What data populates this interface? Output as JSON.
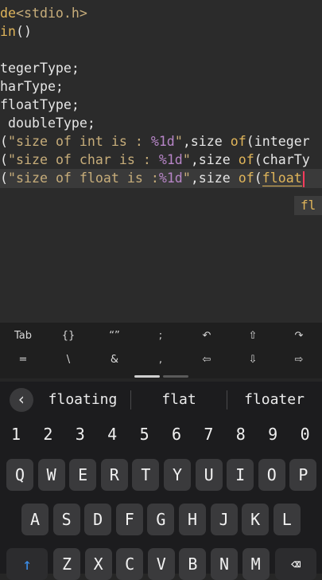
{
  "editor": {
    "lines": [
      {
        "segments": [
          {
            "t": "de",
            "c": "kw"
          },
          {
            "t": "<stdio.h>",
            "c": "str"
          }
        ]
      },
      {
        "segments": [
          {
            "t": "in",
            "c": "kw"
          },
          {
            "t": "()",
            "c": ""
          }
        ]
      },
      {
        "segments": []
      },
      {
        "segments": [
          {
            "t": "tegerType;",
            "c": ""
          }
        ]
      },
      {
        "segments": [
          {
            "t": "harType;",
            "c": ""
          }
        ]
      },
      {
        "segments": [
          {
            "t": "floatType;",
            "c": ""
          }
        ]
      },
      {
        "segments": [
          {
            "t": " doubleType;",
            "c": ""
          }
        ]
      },
      {
        "segments": [
          {
            "t": "(",
            "c": ""
          },
          {
            "t": "\"size of int is : ",
            "c": "str"
          },
          {
            "t": "%1d",
            "c": "fmt"
          },
          {
            "t": "\"",
            "c": "str"
          },
          {
            "t": ",size ",
            "c": ""
          },
          {
            "t": "of",
            "c": "kw"
          },
          {
            "t": "(integer",
            "c": ""
          }
        ]
      },
      {
        "segments": [
          {
            "t": "(",
            "c": ""
          },
          {
            "t": "\"size of char is : ",
            "c": "str"
          },
          {
            "t": "%1d",
            "c": "fmt"
          },
          {
            "t": "\"",
            "c": "str"
          },
          {
            "t": ",size ",
            "c": ""
          },
          {
            "t": "of",
            "c": "kw"
          },
          {
            "t": "(charTy",
            "c": ""
          }
        ]
      },
      {
        "segments": [
          {
            "t": "(",
            "c": ""
          },
          {
            "t": "\"size of float is :",
            "c": "str"
          },
          {
            "t": "%1d",
            "c": "fmt"
          },
          {
            "t": "\"",
            "c": "str"
          },
          {
            "t": ",size ",
            "c": ""
          },
          {
            "t": "of",
            "c": "kw"
          },
          {
            "t": "(",
            "c": ""
          },
          {
            "t": "float",
            "c": "kw"
          }
        ]
      }
    ],
    "autocomplete": "fl"
  },
  "extra_keys": {
    "row1": [
      "Tab",
      "{}",
      "“”",
      ";",
      "↶",
      "⇧",
      "↷"
    ],
    "row2": [
      "=",
      "\\",
      "&",
      ",",
      "⇦",
      "⇩",
      "⇨"
    ]
  },
  "suggestions": [
    "floating",
    "flat",
    "floater"
  ],
  "keyboard": {
    "numbers": [
      "1",
      "2",
      "3",
      "4",
      "5",
      "6",
      "7",
      "8",
      "9",
      "0"
    ],
    "row1": [
      "Q",
      "W",
      "E",
      "R",
      "T",
      "Y",
      "U",
      "I",
      "O",
      "P"
    ],
    "row2": [
      "A",
      "S",
      "D",
      "F",
      "G",
      "H",
      "J",
      "K",
      "L"
    ],
    "row3": [
      "Z",
      "X",
      "C",
      "V",
      "B",
      "N",
      "M"
    ],
    "shift_icon": "shift-arrow-icon",
    "backspace_icon": "backspace-icon"
  },
  "colors": {
    "string": "#c7ad7a",
    "keyword": "#e0b55a",
    "format": "#b785c7",
    "caret": "#ff3b5c",
    "shift_accent": "#3b8eea"
  }
}
